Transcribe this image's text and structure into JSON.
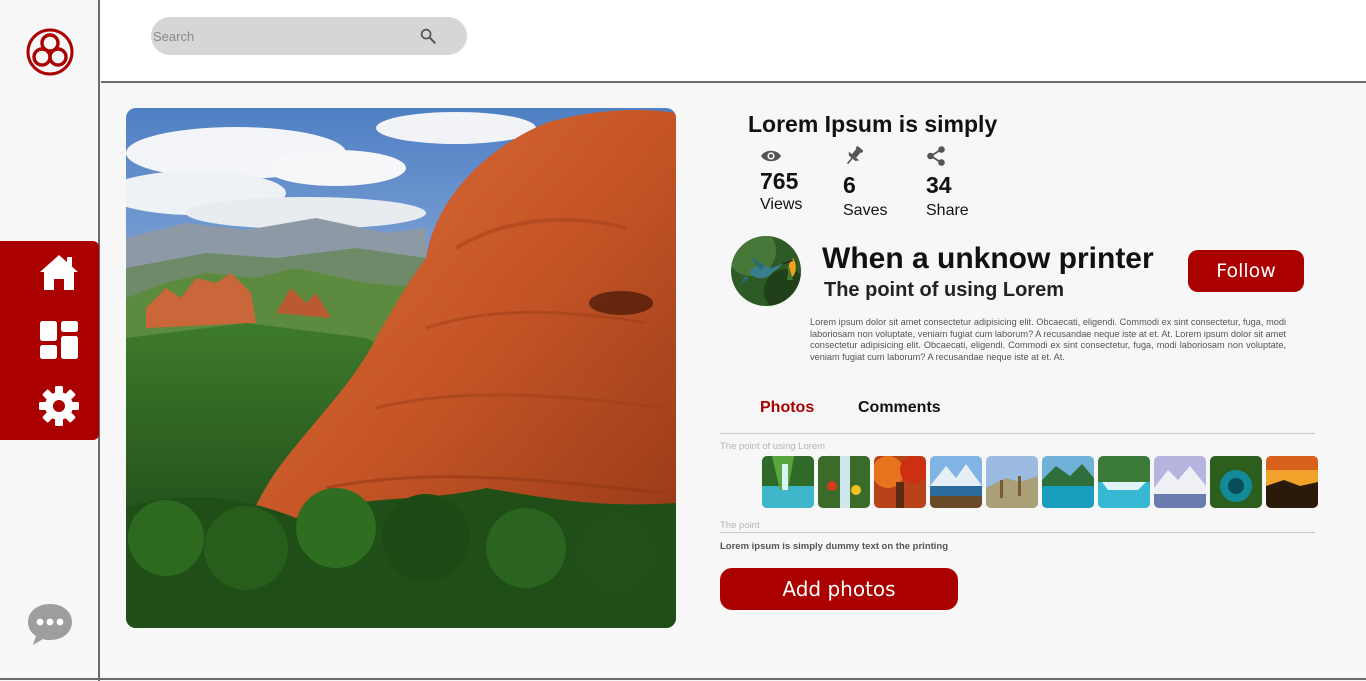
{
  "header": {
    "search_placeholder": "Search"
  },
  "sidebar": {
    "items": [
      {
        "icon": "home-icon"
      },
      {
        "icon": "dashboard-icon"
      },
      {
        "icon": "gear-icon"
      }
    ],
    "chat_icon": "chat-icon"
  },
  "post": {
    "title": "Lorem Ipsum is simply",
    "stats": [
      {
        "icon": "eye-icon",
        "value": "765",
        "label": "Views"
      },
      {
        "icon": "pin-icon",
        "value": "6",
        "label": "Saves"
      },
      {
        "icon": "share-icon",
        "value": "34",
        "label": "Share"
      }
    ]
  },
  "author": {
    "name": "When a unknow printer",
    "subtitle": "The point of using Lorem",
    "follow_label": "Follow",
    "bio": "Lorem ipsum dolor sit amet consectetur adipisicing elit. Obcaecati, eligendi. Commodi ex sint consectetur, fuga, modi laboriosam non voluptate, veniam fugiat cum laborum? A recusandae neque iste at et. At. Lorem ipsum dolor sit amet consectetur adipisicing elit. Obcaecati, eligendi. Commodi ex sint consectetur, fuga, modi laboriosam non voluptate, veniam fugiat cum laborum? A recusandae neque iste at et. At."
  },
  "tabs": [
    {
      "label": "Photos",
      "active": true
    },
    {
      "label": "Comments",
      "active": false
    }
  ],
  "gallery": {
    "caption": "The point of using Lorem",
    "thumb_count_visible": 10
  },
  "section2": {
    "caption": "The point",
    "note": "Lorem ipsum is simply dummy text on the printing"
  },
  "actions": {
    "add_photos_label": "Add photos"
  },
  "colors": {
    "accent": "#aa0000",
    "rail_border": "#6b6b6b"
  }
}
